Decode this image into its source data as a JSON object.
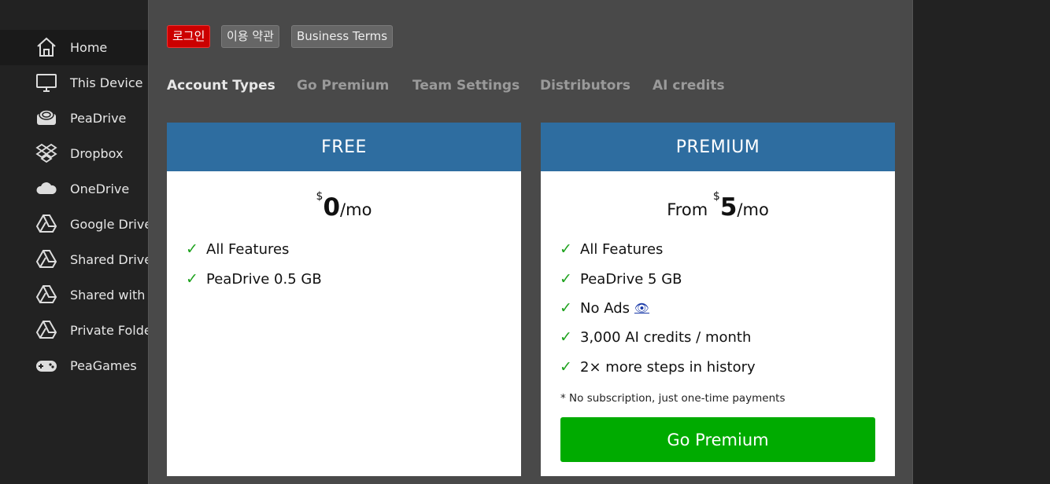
{
  "sidebar": {
    "items": [
      {
        "label": "Home",
        "icon": "home-icon"
      },
      {
        "label": "This Device",
        "icon": "monitor-icon"
      },
      {
        "label": "PeaDrive",
        "icon": "peadrive-icon"
      },
      {
        "label": "Dropbox",
        "icon": "dropbox-icon"
      },
      {
        "label": "OneDrive",
        "icon": "cloud-icon"
      },
      {
        "label": "Google Drive",
        "icon": "google-drive-icon"
      },
      {
        "label": "Shared Drives",
        "icon": "google-drive-icon"
      },
      {
        "label": "Shared with me",
        "icon": "google-drive-icon"
      },
      {
        "label": "Private Folders",
        "icon": "google-drive-icon"
      },
      {
        "label": "PeaGames",
        "icon": "gamepad-icon"
      }
    ]
  },
  "top_links": {
    "login": "로그인",
    "terms": "이용 약관",
    "business_terms": "Business Terms"
  },
  "tabs": [
    "Account Types",
    "Go Premium",
    "Team Settings",
    "Distributors",
    "AI credits"
  ],
  "free": {
    "title": "FREE",
    "currency": "$",
    "amount": "0",
    "period": "/mo",
    "features": [
      "All Features",
      "PeaDrive 0.5 GB"
    ]
  },
  "premium": {
    "title": "PREMIUM",
    "from": "From ",
    "currency": "$",
    "amount": "5",
    "period": "/mo",
    "features": [
      "All Features",
      "PeaDrive 5 GB",
      "No Ads",
      "3,000 AI credits / month",
      "2× more steps in history"
    ],
    "note": "* No subscription, just one-time payments",
    "button": "Go Premium"
  },
  "colors": {
    "accent_blue": "#2e6da0",
    "button_green": "#00ab00",
    "check_green": "#1ea21e",
    "login_red": "#cc0000"
  }
}
